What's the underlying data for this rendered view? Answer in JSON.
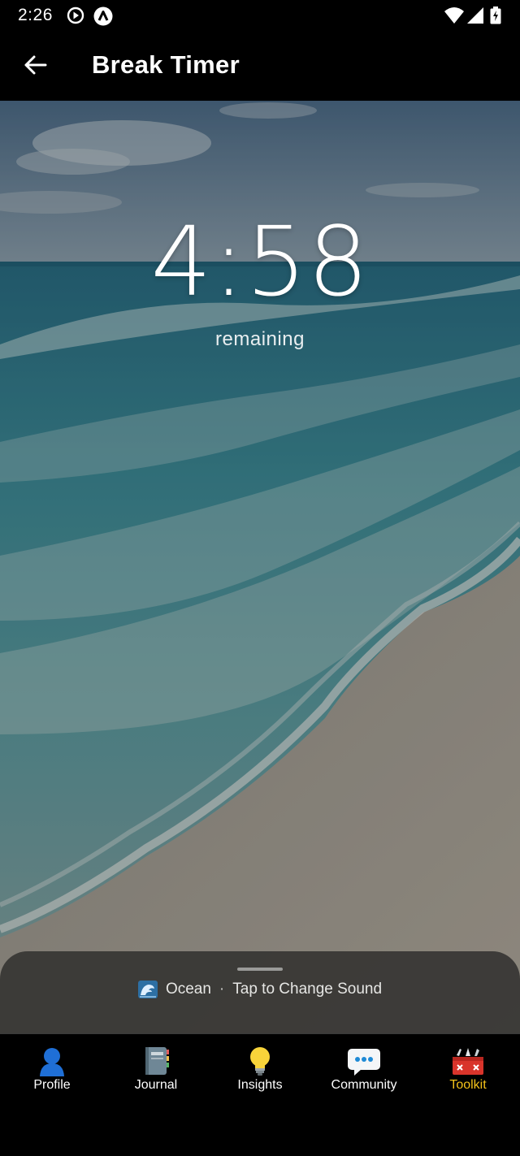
{
  "status_bar": {
    "time": "2:26",
    "icons": [
      "play-circle-icon",
      "app-badge-icon",
      "wifi-icon",
      "signal-icon",
      "battery-charging-icon"
    ]
  },
  "app_bar": {
    "title": "Break Timer",
    "back_icon": "arrow-left-icon"
  },
  "timer": {
    "value": "4:58",
    "caption": "remaining"
  },
  "sound_sheet": {
    "sound_name": "Ocean",
    "separator": "·",
    "action": "Tap to Change Sound",
    "icon": "wave-icon"
  },
  "nav": {
    "items": [
      {
        "label": "Profile",
        "icon": "profile-icon",
        "active": false
      },
      {
        "label": "Journal",
        "icon": "journal-icon",
        "active": false
      },
      {
        "label": "Insights",
        "icon": "lightbulb-icon",
        "active": false
      },
      {
        "label": "Community",
        "icon": "chat-bubble-icon",
        "active": false
      },
      {
        "label": "Toolkit",
        "icon": "toolbox-icon",
        "active": true
      }
    ],
    "active_color": "#f3c21a"
  }
}
